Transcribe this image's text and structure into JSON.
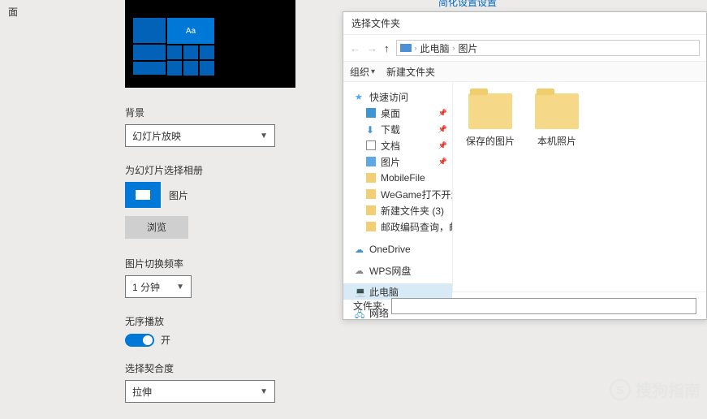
{
  "sidebar": {
    "item": "面"
  },
  "header_links": [
    "简化设置设置"
  ],
  "preview": {
    "tile_text": "Aa"
  },
  "settings": {
    "background_label": "背景",
    "background_value": "幻灯片放映",
    "album_label": "为幻灯片选择相册",
    "album_value": "图片",
    "browse": "浏览",
    "interval_label": "图片切换频率",
    "interval_value": "1 分钟",
    "shuffle_label": "无序播放",
    "shuffle_state": "开",
    "fit_label": "选择契合度",
    "fit_value": "拉伸"
  },
  "dialog": {
    "title": "选择文件夹",
    "breadcrumb": [
      "此电脑",
      "图片"
    ],
    "toolbar": {
      "organize": "组织",
      "newfolder": "新建文件夹"
    },
    "tree": [
      {
        "icon": "star",
        "label": "快速访问",
        "type": "head"
      },
      {
        "icon": "desk",
        "label": "桌面",
        "pin": true,
        "type": "sub"
      },
      {
        "icon": "down",
        "label": "下载",
        "pin": true,
        "type": "sub"
      },
      {
        "icon": "doc",
        "label": "文档",
        "pin": true,
        "type": "sub"
      },
      {
        "icon": "pic",
        "label": "图片",
        "pin": true,
        "type": "sub"
      },
      {
        "icon": "folder",
        "label": "MobileFile",
        "type": "sub"
      },
      {
        "icon": "folder",
        "label": "WeGame打不开怎",
        "type": "sub"
      },
      {
        "icon": "folder",
        "label": "新建文件夹 (3)",
        "type": "sub"
      },
      {
        "icon": "folder",
        "label": "邮政编码查询，邮",
        "type": "sub"
      },
      {
        "icon": "onedrive",
        "label": "OneDrive",
        "type": "head"
      },
      {
        "icon": "wps",
        "label": "WPS网盘",
        "type": "head"
      },
      {
        "icon": "pc",
        "label": "此电脑",
        "type": "head",
        "selected": true
      },
      {
        "icon": "net",
        "label": "网络",
        "type": "head"
      }
    ],
    "folders": [
      "保存的图片",
      "本机照片"
    ],
    "footer_label": "文件夹:",
    "footer_value": ""
  },
  "watermark": {
    "brand": "搜狗指南",
    "s": "S",
    "url": ""
  }
}
